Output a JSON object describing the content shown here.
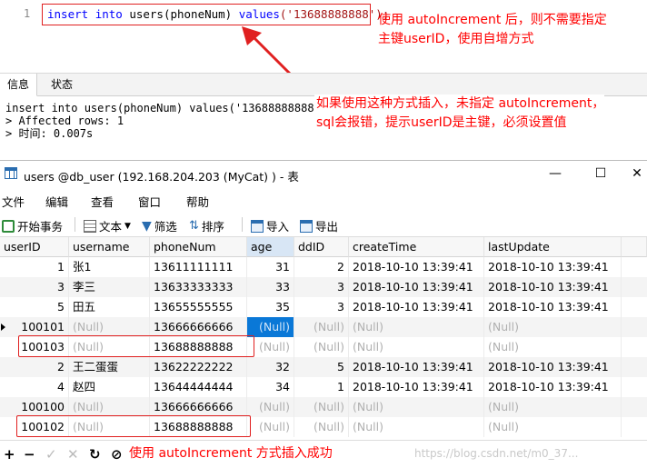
{
  "editor": {
    "line_number": "1",
    "code_kw1": "insert",
    "code_kw2": "into",
    "code_mid": "users(phoneNum)",
    "code_kw3": "values",
    "code_str": "('13688888888');"
  },
  "annotations": {
    "top_line1": "使用 autoIncrement 后，则不需要指定",
    "top_line2": "主键userID，使用自增方式",
    "mid_line1": "如果使用这种方式插入，未指定 autoIncrement，",
    "mid_line2": "sql会报错，提示userID是主键，必须设置值",
    "bottom": "使用 autoIncrement 方式插入成功",
    "color": "#ff0000"
  },
  "info_panel": {
    "tabs": [
      "信息",
      "状态"
    ],
    "output_lines": [
      "insert into users(phoneNum) values('13688888888')",
      "> Affected rows: 1",
      "> 时间: 0.007s"
    ]
  },
  "window": {
    "title": "users @db_user (192.168.204.203 (MyCat) ) - 表",
    "menu": [
      "文件",
      "编辑",
      "查看",
      "窗口",
      "帮助"
    ],
    "toolbar": {
      "begin_tx": "开始事务",
      "text": "文本",
      "filter": "筛选",
      "sort": "排序",
      "import": "导入",
      "export": "导出"
    }
  },
  "grid": {
    "columns": [
      "userID",
      "username",
      "phoneNum",
      "age",
      "ddID",
      "createTime",
      "lastUpdate"
    ],
    "rows": [
      [
        "1",
        "张1",
        "13611111111",
        "31",
        "2",
        "2018-10-10 13:39:41",
        "2018-10-10 13:39:41"
      ],
      [
        "3",
        "李三",
        "13633333333",
        "33",
        "3",
        "2018-10-10 13:39:41",
        "2018-10-10 13:39:41"
      ],
      [
        "5",
        "田五",
        "13655555555",
        "35",
        "3",
        "2018-10-10 13:39:41",
        "2018-10-10 13:39:41"
      ],
      [
        "100101",
        "(Null)",
        "13666666666",
        "(Null)",
        "(Null)",
        "(Null)",
        "(Null)"
      ],
      [
        "100103",
        "(Null)",
        "13688888888",
        "(Null)",
        "(Null)",
        "(Null)",
        "(Null)"
      ],
      [
        "2",
        "王二蛋蛋",
        "13622222222",
        "32",
        "5",
        "2018-10-10 13:39:41",
        "2018-10-10 13:39:41"
      ],
      [
        "4",
        "赵四",
        "13644444444",
        "34",
        "1",
        "2018-10-10 13:39:41",
        "2018-10-10 13:39:41"
      ],
      [
        "100100",
        "(Null)",
        "13666666666",
        "(Null)",
        "(Null)",
        "(Null)",
        "(Null)"
      ],
      [
        "100102",
        "(Null)",
        "13688888888",
        "(Null)",
        "(Null)",
        "(Null)",
        "(Null)"
      ]
    ]
  },
  "status": {
    "watermark": "https://blog.csdn.net/m0_37...",
    "accent": "#0a78d7"
  }
}
